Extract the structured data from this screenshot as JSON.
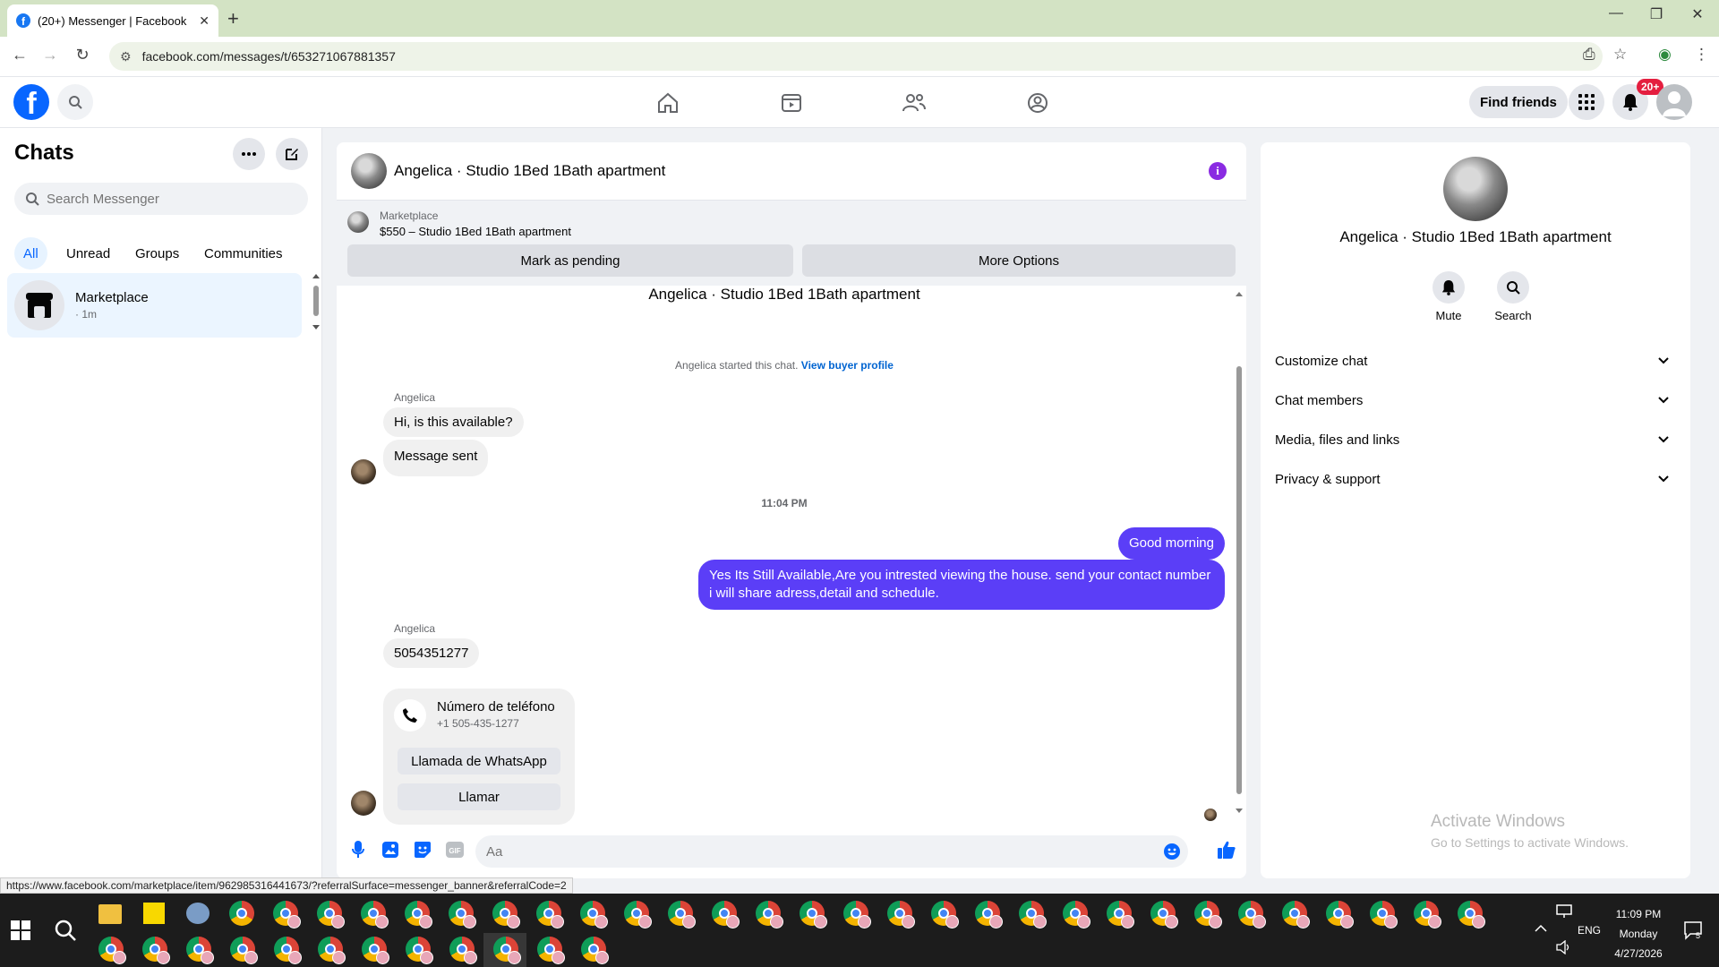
{
  "browser": {
    "tab_title": "(20+) Messenger | Facebook",
    "url": "facebook.com/messages/t/653271067881357",
    "status_url": "https://www.facebook.com/marketplace/item/962985316441673/?referralSurface=messenger_banner&referralCode=2"
  },
  "fb_header": {
    "find_friends": "Find friends",
    "notif_badge": "20+",
    "logo_letter": "f"
  },
  "sidebar": {
    "title": "Chats",
    "search_placeholder": "Search Messenger",
    "filters": [
      "All",
      "Unread",
      "Groups",
      "Communities"
    ],
    "active_filter": "All",
    "chats": [
      {
        "name": "Marketplace",
        "time": "· 1m"
      }
    ]
  },
  "chat": {
    "title": "Angelica · Studio 1Bed 1Bath apartment",
    "banner": {
      "label": "Marketplace",
      "listing": "$550 – Studio 1Bed 1Bath apartment",
      "btn_pending": "Mark as pending",
      "btn_more": "More Options"
    },
    "conv_title": "Angelica · Studio 1Bed 1Bath apartment",
    "started_text": "Angelica started this chat.",
    "started_link": "View buyer profile",
    "sender1": "Angelica",
    "msg_in_1": "Hi, is this available?",
    "msg_in_2": "Message sent",
    "timestamp": "11:04 PM",
    "msg_out_1": "Good morning",
    "msg_out_2": "Yes Its Still Available,Are you intrested viewing the house. send your contact number i will share adress,detail and schedule.",
    "sender2": "Angelica",
    "msg_in_3": "5054351277",
    "phone_card": {
      "title": "Número de teléfono",
      "number": "+1 505-435-1277",
      "btn_whatsapp": "Llamada de WhatsApp",
      "btn_call": "Llamar"
    },
    "composer_placeholder": "Aa"
  },
  "right_panel": {
    "name": "Angelica · Studio 1Bed 1Bath apartment",
    "actions": [
      "Mute",
      "Search"
    ],
    "sections": [
      "Customize chat",
      "Chat members",
      "Media, files and links",
      "Privacy & support"
    ],
    "watermark_1": "Activate Windows",
    "watermark_2": "Go to Settings to activate Windows."
  },
  "taskbar": {
    "time": "11:09 PM",
    "day": "Monday",
    "date": "4/27/2026",
    "lang": "ENG",
    "notif_count": "5"
  },
  "colors": {
    "fb_blue": "#0866ff",
    "outgoing_bubble": "#5b3ef7",
    "active_chat_bg": "#ebf5ff",
    "notif_red": "#e41e3f"
  }
}
